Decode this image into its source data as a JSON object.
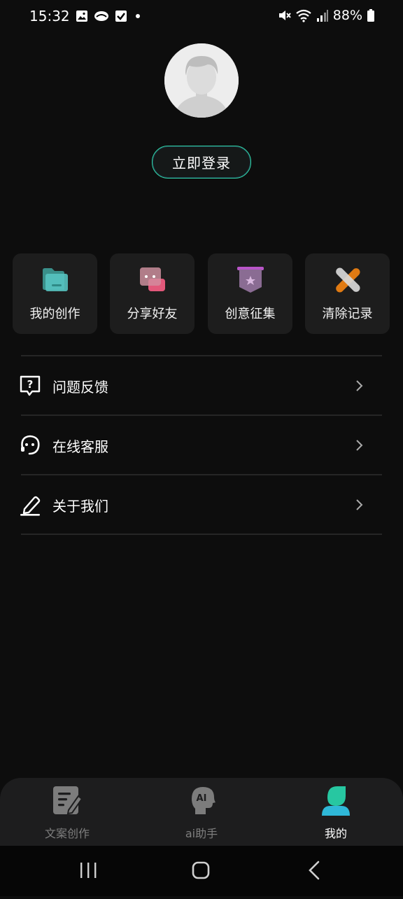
{
  "status_bar": {
    "time": "15:32",
    "battery": "88%",
    "left_icons": [
      "image-icon",
      "cloud-icon",
      "checkbox-icon",
      "dot-icon"
    ],
    "right_icons": [
      "mute-icon",
      "wifi-icon",
      "signal-icon",
      "battery-icon"
    ]
  },
  "profile": {
    "avatar_icon": "default-avatar-icon",
    "login_label": "立即登录",
    "accent_color": "#2fd3a6"
  },
  "quick_actions": [
    {
      "label": "我的创作",
      "icon": "folder-icon"
    },
    {
      "label": "分享好友",
      "icon": "chat-bubble-icon"
    },
    {
      "label": "创意征集",
      "icon": "ribbon-badge-icon"
    },
    {
      "label": "清除记录",
      "icon": "eraser-icon"
    }
  ],
  "menu": [
    {
      "label": "问题反馈",
      "icon": "feedback-icon"
    },
    {
      "label": "在线客服",
      "icon": "customer-service-icon"
    },
    {
      "label": "关于我们",
      "icon": "pen-icon"
    }
  ],
  "tabs": [
    {
      "label": "文案创作",
      "icon": "write-icon",
      "active": false
    },
    {
      "label": "ai助手",
      "icon": "ai-head-icon",
      "active": false
    },
    {
      "label": "我的",
      "icon": "user-icon",
      "active": true
    }
  ],
  "tab_active_color": "#23c4b4",
  "nav_bar": [
    "recents-icon",
    "home-icon",
    "back-icon"
  ]
}
